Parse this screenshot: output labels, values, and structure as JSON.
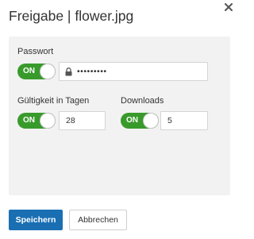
{
  "dialog": {
    "title": "Freigabe | flower.jpg",
    "close_icon": "close-icon"
  },
  "password": {
    "label": "Passwort",
    "toggle_label": "ON",
    "toggle_on": true,
    "masked_value": "•••••••••",
    "icon": "lock-icon"
  },
  "validity": {
    "label": "Gültigkeit in Tagen",
    "toggle_label": "ON",
    "toggle_on": true,
    "value": "28"
  },
  "downloads": {
    "label": "Downloads",
    "toggle_label": "ON",
    "toggle_on": true,
    "value": "5"
  },
  "buttons": {
    "save": "Speichern",
    "cancel": "Abbrechen"
  },
  "colors": {
    "toggle_on": "#399a2c",
    "primary": "#1a6fb3",
    "panel": "#f2f2f2"
  }
}
